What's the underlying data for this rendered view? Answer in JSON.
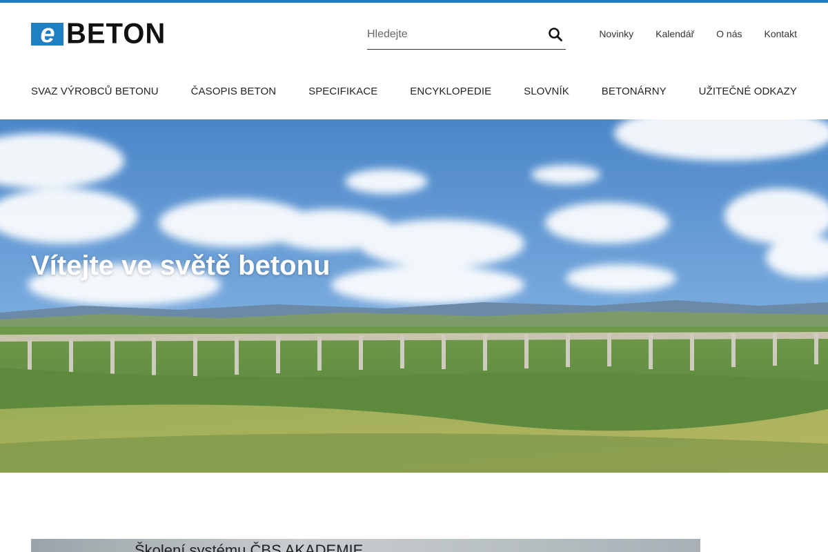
{
  "colors": {
    "accent": "#1e7fc4"
  },
  "logo": {
    "letter": "e",
    "word": "BETON"
  },
  "search": {
    "placeholder": "Hledejte",
    "icon": "search-icon"
  },
  "util_nav": [
    {
      "label": "Novinky"
    },
    {
      "label": "Kalendář"
    },
    {
      "label": "O nás"
    },
    {
      "label": "Kontakt"
    }
  ],
  "main_nav": [
    {
      "label": "SVAZ VÝROBCŮ BETONU"
    },
    {
      "label": "ČASOPIS BETON"
    },
    {
      "label": "SPECIFIKACE"
    },
    {
      "label": "ENCYKLOPEDIE"
    },
    {
      "label": "SLOVNÍK"
    },
    {
      "label": "BETONÁRNY"
    },
    {
      "label": "UŽITEČNÉ ODKAZY"
    }
  ],
  "hero": {
    "title": "Vítejte ve světě betonu"
  },
  "teaser": {
    "text": "Školení systému ČBS AKADEMIE"
  }
}
